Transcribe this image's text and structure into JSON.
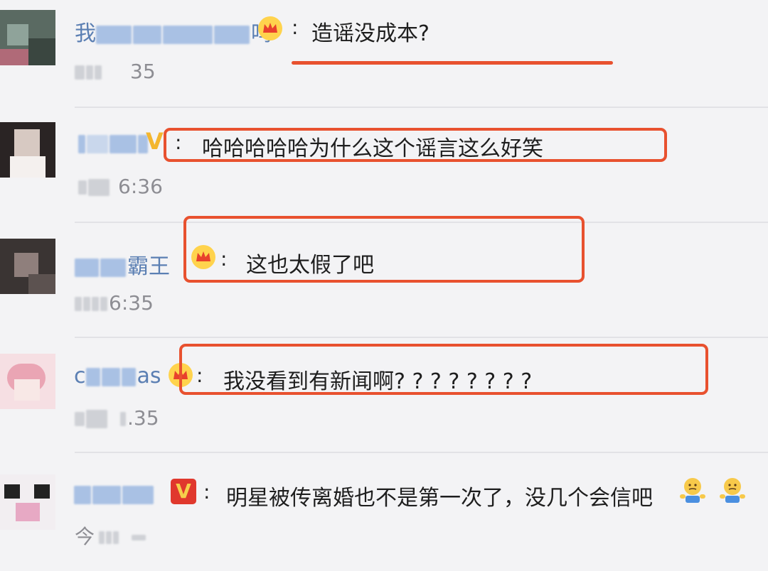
{
  "comments": [
    {
      "name_visible": "我",
      "name_tail": "吗",
      "badge": "crown-icon",
      "colon": ":",
      "text": "造谣没成本?",
      "time": "35",
      "highlight": "underline"
    },
    {
      "name_visible": "",
      "name_tail": "",
      "badge": "v-badge-icon",
      "colon": ":",
      "text": "哈哈哈哈哈为什么这个谣言这么好笑",
      "time": "6:36",
      "highlight": "box"
    },
    {
      "name_visible": "",
      "name_tail": "霸王",
      "badge": "crown-icon",
      "colon": ":",
      "text": "这也太假了吧",
      "time": "6:35",
      "highlight": "box"
    },
    {
      "name_visible": "c",
      "name_tail": "as",
      "badge": "crown-icon",
      "colon": ":",
      "text": "我没看到有新闻啊? ? ? ? ? ? ? ?",
      "time": ".35",
      "highlight": "box"
    },
    {
      "name_visible": "",
      "name_tail": "",
      "badge": "red-v-badge-icon",
      "colon": ":",
      "text": "明星被传离婚也不是第一次了，没几个会信吧",
      "time": "今",
      "emojis": [
        "shrug-emoji-icon",
        "shrug-emoji-icon"
      ],
      "highlight": "none"
    }
  ],
  "colors": {
    "highlight": "#e8512f",
    "username": "#5b7fb3",
    "background": "#f3f3f5"
  }
}
